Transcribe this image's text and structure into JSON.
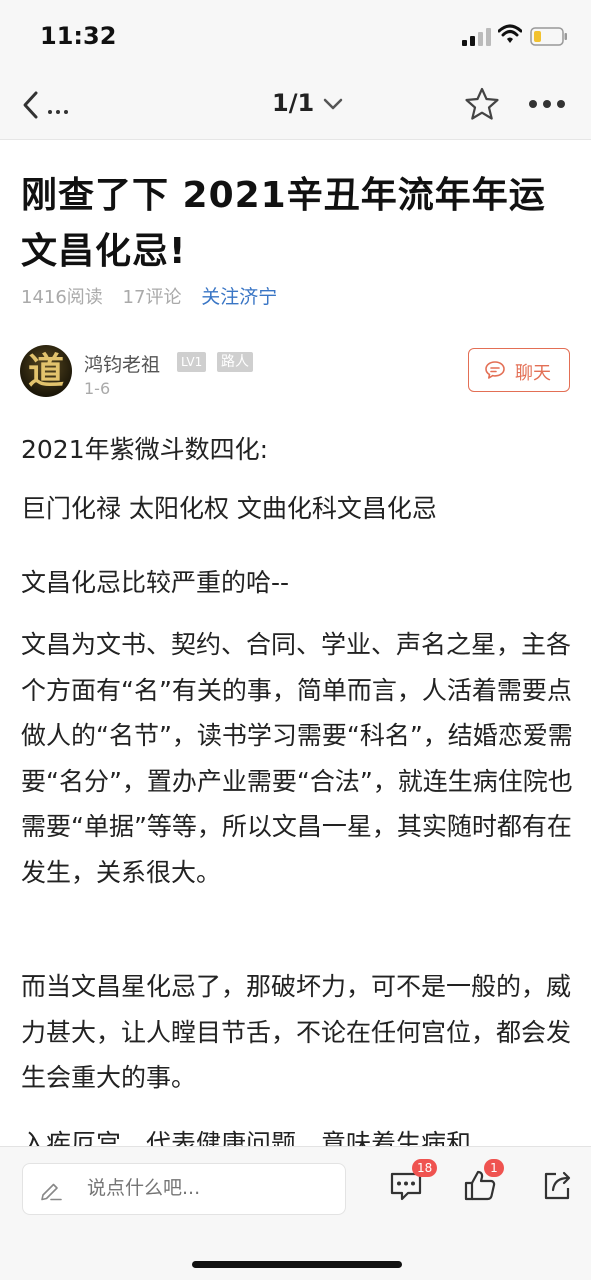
{
  "status_bar": {
    "time": "11:32"
  },
  "nav": {
    "back_label": "…",
    "page_indicator": "1/1"
  },
  "article": {
    "title": "刚查了下 2021辛丑年流年年运文昌化忌!",
    "reads": "1416阅读",
    "comments": "17评论",
    "follow": "关注济宁"
  },
  "author": {
    "name": "鸿钧老祖",
    "level": "LV1",
    "role": "路人",
    "date": "1-6",
    "avatar_glyph": "道",
    "chat_label": "聊天"
  },
  "body": [
    "2021年紫微斗数四化:",
    "巨门化禄 太阳化权 文曲化科文昌化忌",
    "文昌化忌比较严重的哈--",
    "文昌为文书、契约、合同、学业、声名之星，主各个方面有“名”有关的事，简单而言，人活着需要点做人的“名节”，读书学习需要“科名”，结婚恋爱需要“名分”，置办产业需要“合法”，就连生病住院也需要“单据”等等，所以文昌一星，其实随时都有在发生，关系很大。",
    "而当文昌星化忌了，那破坏力，可不是一般的，威力甚大，让人瞠目节舌，不论在任何宫位，都会发生会重大的事。",
    "入疾厄宫，代表健康问题，意味着生病和"
  ],
  "bottom_bar": {
    "comment_placeholder": "说点什么吧...",
    "comment_count": "18",
    "like_count": "1"
  },
  "colors": {
    "accent": "#e36f55",
    "link": "#3a76c5",
    "badge": "#ef5350"
  }
}
